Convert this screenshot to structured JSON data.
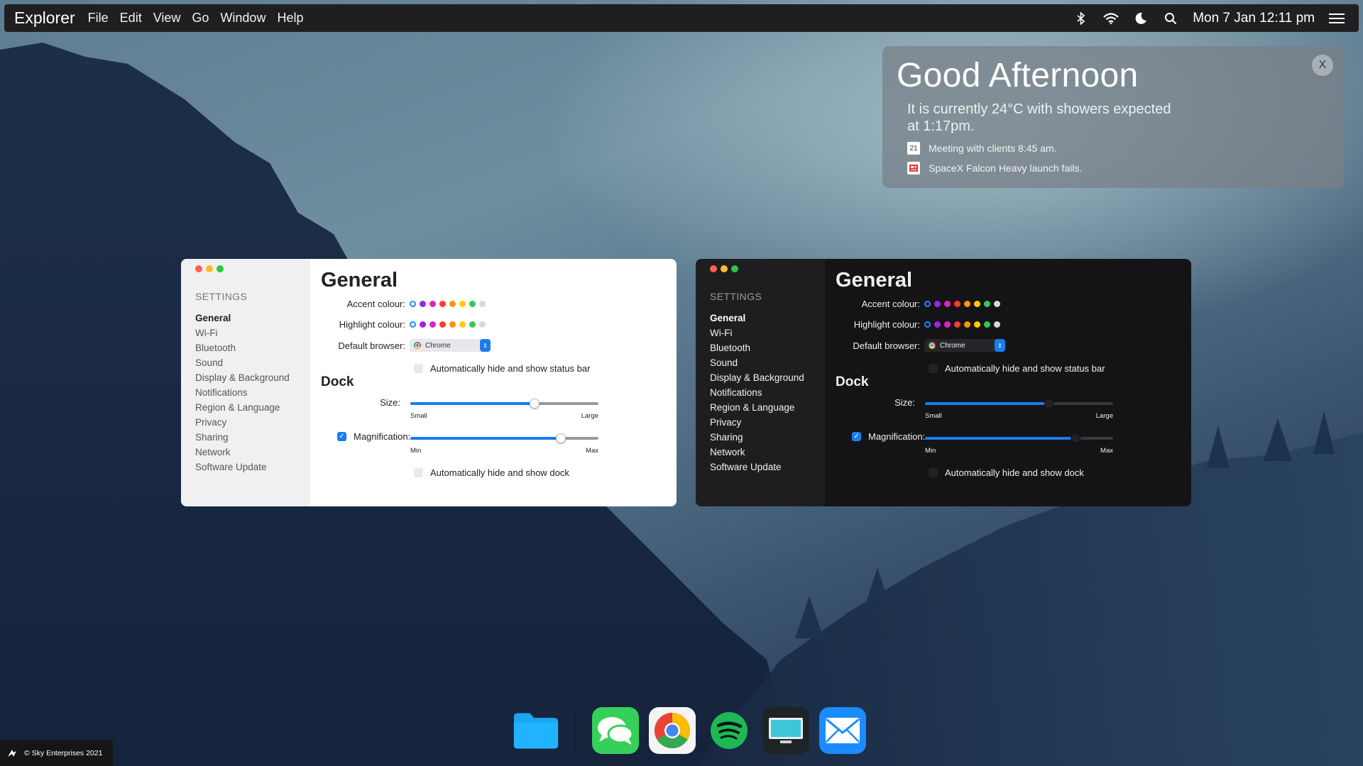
{
  "menubar": {
    "app_name": "Explorer",
    "menus": [
      "File",
      "Edit",
      "View",
      "Go",
      "Window",
      "Help"
    ],
    "clock": "Mon 7 Jan 12:11 pm",
    "icons": [
      "bluetooth-icon",
      "wifi-icon",
      "moon-icon",
      "search-icon",
      "menu-icon"
    ]
  },
  "notification": {
    "greeting": "Good Afternoon",
    "weather": "It is currently 24°C with showers expected at 1:17pm.",
    "calendar_day": "21",
    "items": [
      "Meeting with clients 8:45 am.",
      "SpaceX Falcon Heavy launch fails."
    ],
    "close_label": "X"
  },
  "settings": {
    "sidebar_header": "SETTINGS",
    "sidebar_items": [
      "General",
      "Wi-Fi",
      "Bluetooth",
      "Sound",
      "Display & Background",
      "Notifications",
      "Region & Language",
      "Privacy",
      "Sharing",
      "Network",
      "Software Update"
    ],
    "active_item": "General",
    "title": "General",
    "accent_label": "Accent colour:",
    "highlight_label": "Highlight colour:",
    "browser_label": "Default browser:",
    "browser_value": "Chrome",
    "status_bar_label": "Automatically hide and show status bar",
    "dock_header": "Dock",
    "size_label": "Size:",
    "size_min": "Small",
    "size_max": "Large",
    "size_value": 0.66,
    "magnification_label": "Magnification:",
    "mag_min": "Min",
    "mag_max": "Max",
    "mag_value": 0.8,
    "dock_hide_label": "Automatically hide and show dock",
    "swatches": [
      "#1a8cff",
      "#a020f0",
      "#e020c8",
      "#ff3b30",
      "#ff9500",
      "#ffcc00",
      "#34c759",
      "#d8d8d8"
    ],
    "traffic_lights": [
      "#ff5f57",
      "#febc2e",
      "#28c840"
    ]
  },
  "dock": {
    "apps": [
      "Files",
      "Messages",
      "Chrome",
      "Spotify",
      "Screen",
      "Mail"
    ]
  },
  "footer": {
    "copyright": "© Sky Enterprises 2021"
  }
}
